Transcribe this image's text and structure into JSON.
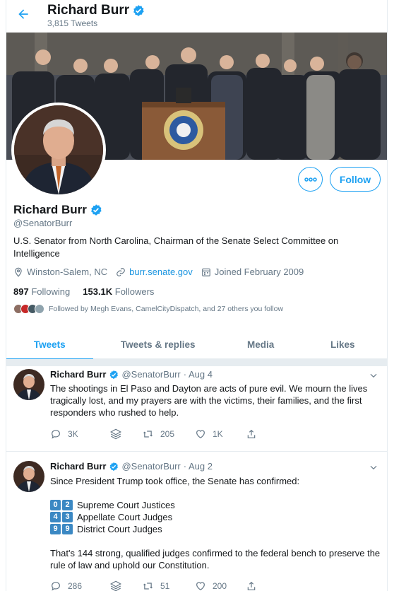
{
  "header": {
    "name": "Richard Burr",
    "tweet_count": "3,815 Tweets"
  },
  "profile": {
    "name": "Richard Burr",
    "handle": "@SenatorBurr",
    "bio": "U.S. Senator from North Carolina, Chairman of the Senate Select Committee on Intelligence",
    "location": "Winston-Salem, NC",
    "website": "burr.senate.gov",
    "joined": "Joined February 2009",
    "following_count": "897",
    "following_label": "Following",
    "followers_count": "153.1K",
    "followers_label": "Followers",
    "followed_by": "Followed by Megh Evans, CamelCityDispatch, and 27 others you follow"
  },
  "buttons": {
    "follow": "Follow",
    "more_icon": "more-icon"
  },
  "tabs": [
    {
      "label": "Tweets",
      "active": true
    },
    {
      "label": "Tweets & replies",
      "active": false
    },
    {
      "label": "Media",
      "active": false
    },
    {
      "label": "Likes",
      "active": false
    }
  ],
  "tweets": [
    {
      "name": "Richard Burr",
      "handle": "@SenatorBurr",
      "date": "· Aug 4",
      "text": "The shootings in El Paso and Dayton are acts of pure evil. We mourn the lives tragically lost, and my prayers are with the victims, their families, and the first responders who rushed to help.",
      "replies": "3K",
      "retweets": "205",
      "likes": "1K"
    },
    {
      "name": "Richard Burr",
      "handle": "@SenatorBurr",
      "date": "· Aug 2",
      "intro": "Since President Trump took office, the Senate has confirmed:",
      "lines": [
        {
          "digits": [
            "0",
            "2"
          ],
          "label": "Supreme Court Justices"
        },
        {
          "digits": [
            "4",
            "3"
          ],
          "label": "Appellate Court Judges"
        },
        {
          "digits": [
            "9",
            "9"
          ],
          "label": "District Court Judges"
        }
      ],
      "outro": "That's 144 strong, qualified judges confirmed to the federal bench to preserve the rule of law and uphold our Constitution.",
      "replies": "286",
      "retweets": "51",
      "likes": "200"
    }
  ],
  "colors": {
    "accent": "#1da1f2",
    "link": "#1b95e0",
    "muted": "#657786",
    "border": "#e6ecf0",
    "keycap": "#3b88c3"
  }
}
